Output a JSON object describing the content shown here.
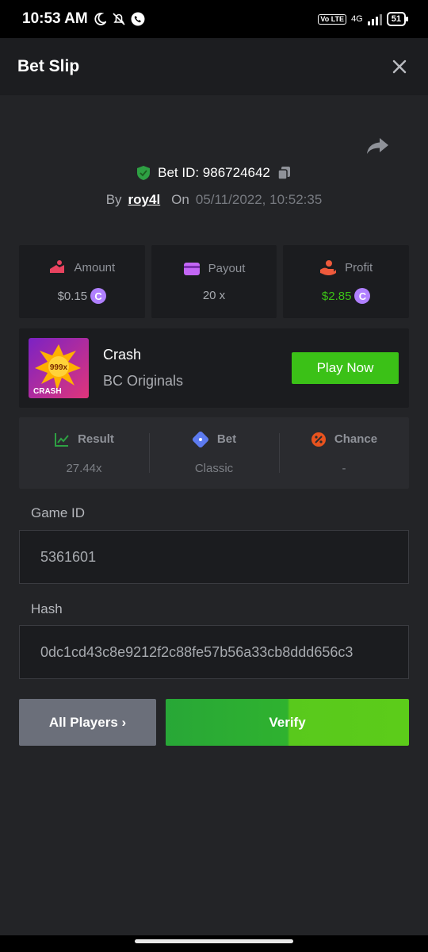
{
  "status_bar": {
    "time": "10:53 AM",
    "network": "4G",
    "volte": "Vo LTE",
    "battery": "51",
    "icons": [
      "moon-icon",
      "muted-bell-icon",
      "phone-icon"
    ]
  },
  "header": {
    "title": "Bet Slip",
    "close_icon": "close-icon"
  },
  "bet": {
    "id_text": "Bet ID: 986724642",
    "by_label": "By",
    "user": "roy4l",
    "on_label": "On",
    "date": "05/11/2022, 10:52:35"
  },
  "stats": {
    "amount_label": "Amount",
    "amount_value": "$0.15",
    "payout_label": "Payout",
    "payout_value": "20 x",
    "profit_label": "Profit",
    "profit_value": "$2.85",
    "coin_symbol": "C"
  },
  "game": {
    "name": "Crash",
    "provider": "BC Originals",
    "play_label": "Play Now",
    "thumb_text": "CRASH",
    "thumb_badge": "999x"
  },
  "info": {
    "result_label": "Result",
    "result_value": "27.44x",
    "bet_label": "Bet",
    "bet_value": "Classic",
    "chance_label": "Chance",
    "chance_value": "-"
  },
  "fields": {
    "game_id_label": "Game ID",
    "game_id_value": "5361601",
    "hash_label": "Hash",
    "hash_value": "0dc1cd43c8e9212f2c88fe57b56a33cb8ddd656c3"
  },
  "actions": {
    "all_players_label": "All Players ›",
    "verify_label": "Verify"
  },
  "colors": {
    "background": "#232427",
    "card": "#1b1c1f",
    "accent_green": "#3bc117",
    "coin_purple": "#b080ff"
  }
}
